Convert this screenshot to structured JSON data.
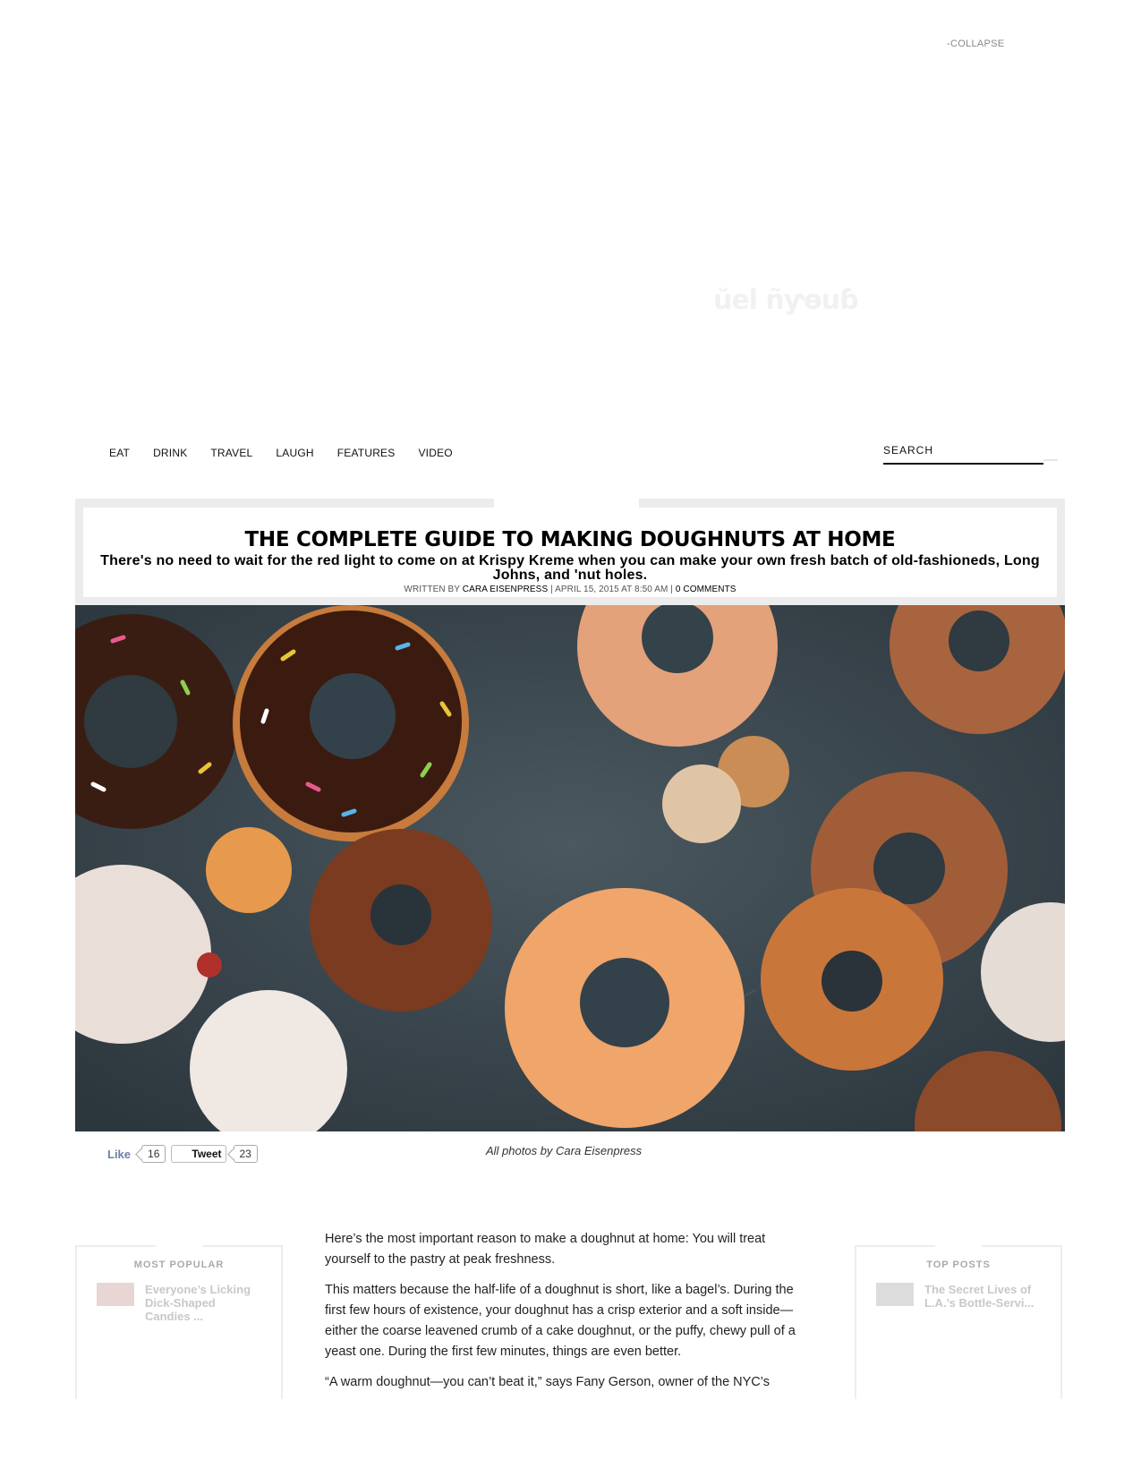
{
  "top": {
    "collapse": "-COLLAPSE",
    "logo_text": "ŭel ñƴɵuɓ"
  },
  "nav": {
    "items": [
      "EAT",
      "DRINK",
      "TRAVEL",
      "LAUGH",
      "FEATURES",
      "VIDEO"
    ]
  },
  "search": {
    "placeholder": "SEARCH"
  },
  "article_header": {
    "title": "THE COMPLETE GUIDE TO MAKING DOUGHNUTS AT HOME",
    "subtitle": "There's no need to wait for the red light to come on at Krispy Kreme when you can make your own fresh batch of old-fashioneds, Long Johns, and 'nut holes.",
    "written_by": "WRITTEN BY",
    "author": "CARA EISENPRESS",
    "date": "| APRIL 15, 2015 AT 8:50 AM |",
    "comments": "0 COMMENTS"
  },
  "hero": {
    "caption": "All photos by Cara Eisenpress"
  },
  "social": {
    "like_label": "Like",
    "like_count": "16",
    "tweet_label": "Tweet",
    "tweet_count": "23"
  },
  "most_popular": {
    "heading": "MOST POPULAR",
    "item_title": "Everyone’s Licking Dick-Shaped Candies ..."
  },
  "top_posts": {
    "heading": "TOP POSTS",
    "item_title": "The Secret Lives of L.A.’s Bottle-Servi..."
  },
  "body": {
    "paragraphs": [
      "Here’s the most important reason to make a doughnut at home: You will treat yourself to the pastry at peak freshness.",
      "This matters because the half-life of a doughnut is short, like a bagel’s. During the first few hours of existence, your doughnut has a crisp exterior and a soft inside—either the coarse leavened crumb of a cake doughnut, or the puffy, chewy pull of a yeast one. During the first few minutes, things are even better.",
      "“A warm doughnut—you can’t beat it,” says Fany Gerson, owner of the NYC’s"
    ]
  },
  "colors": {
    "slate": "#3b4850",
    "like_blue": "#6d7fa8",
    "frame_gray": "#ececec"
  }
}
